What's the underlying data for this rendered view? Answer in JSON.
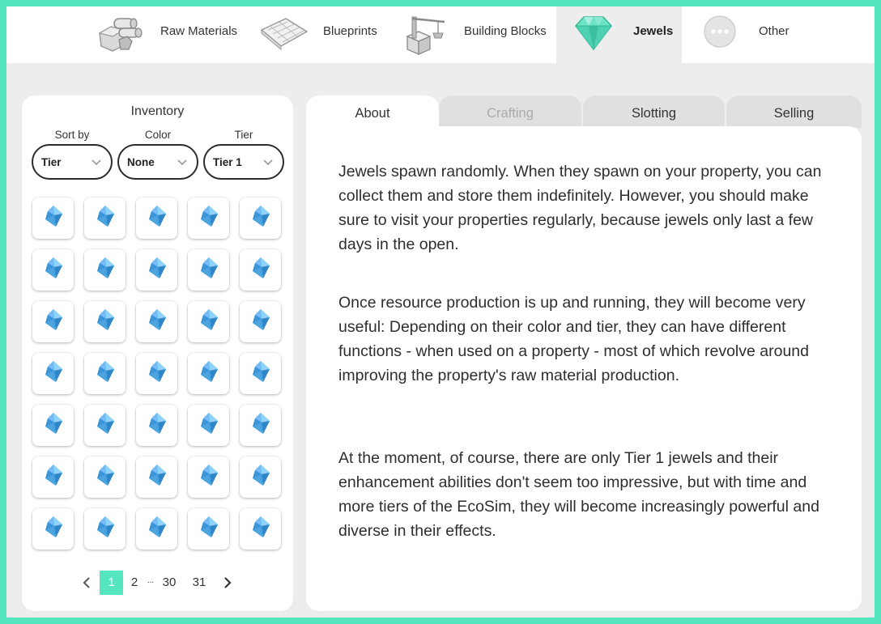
{
  "nav": {
    "items": [
      {
        "label": "Raw Materials",
        "icon": "raw-materials-icon"
      },
      {
        "label": "Blueprints",
        "icon": "blueprint-icon"
      },
      {
        "label": "Building Blocks",
        "icon": "building-blocks-icon"
      },
      {
        "label": "Jewels",
        "icon": "jewel-icon",
        "active": true
      },
      {
        "label": "Other",
        "icon": "more-icon"
      }
    ]
  },
  "inventory": {
    "title": "Inventory",
    "filters": [
      {
        "label": "Sort by",
        "value": "Tier"
      },
      {
        "label": "Color",
        "value": "None"
      },
      {
        "label": "Tier",
        "value": "Tier 1"
      }
    ],
    "item_icon": "blue-jewel-icon",
    "pagination": {
      "pages": [
        "1",
        "2",
        "...",
        "30",
        "31"
      ],
      "current": "1"
    }
  },
  "tabs": [
    {
      "label": "About",
      "state": "active"
    },
    {
      "label": "Crafting",
      "state": "disabled"
    },
    {
      "label": "Slotting",
      "state": "normal"
    },
    {
      "label": "Selling",
      "state": "normal"
    }
  ],
  "about": {
    "paragraphs": [
      "Jewels spawn randomly. When they spawn on your property, you can collect them and store them indefinitely. However, you should make sure to visit your properties regularly, because jewels only last a few days in the open.",
      "Once resource production is up and running, they will become very useful: Depending on their color and tier, they can have different functions - when used on a property - most of which revolve around improving the property's raw material production.",
      "At the moment, of course, there are only Tier 1 jewels and their enhancement abilities don't seem too impressive, but with time and more tiers of the EcoSim, they will become increasingly powerful and diverse in their effects."
    ]
  },
  "colors": {
    "accent": "#55e6bf",
    "jewel_blue": "#4aa8e8",
    "panel_bg": "#ededed"
  }
}
